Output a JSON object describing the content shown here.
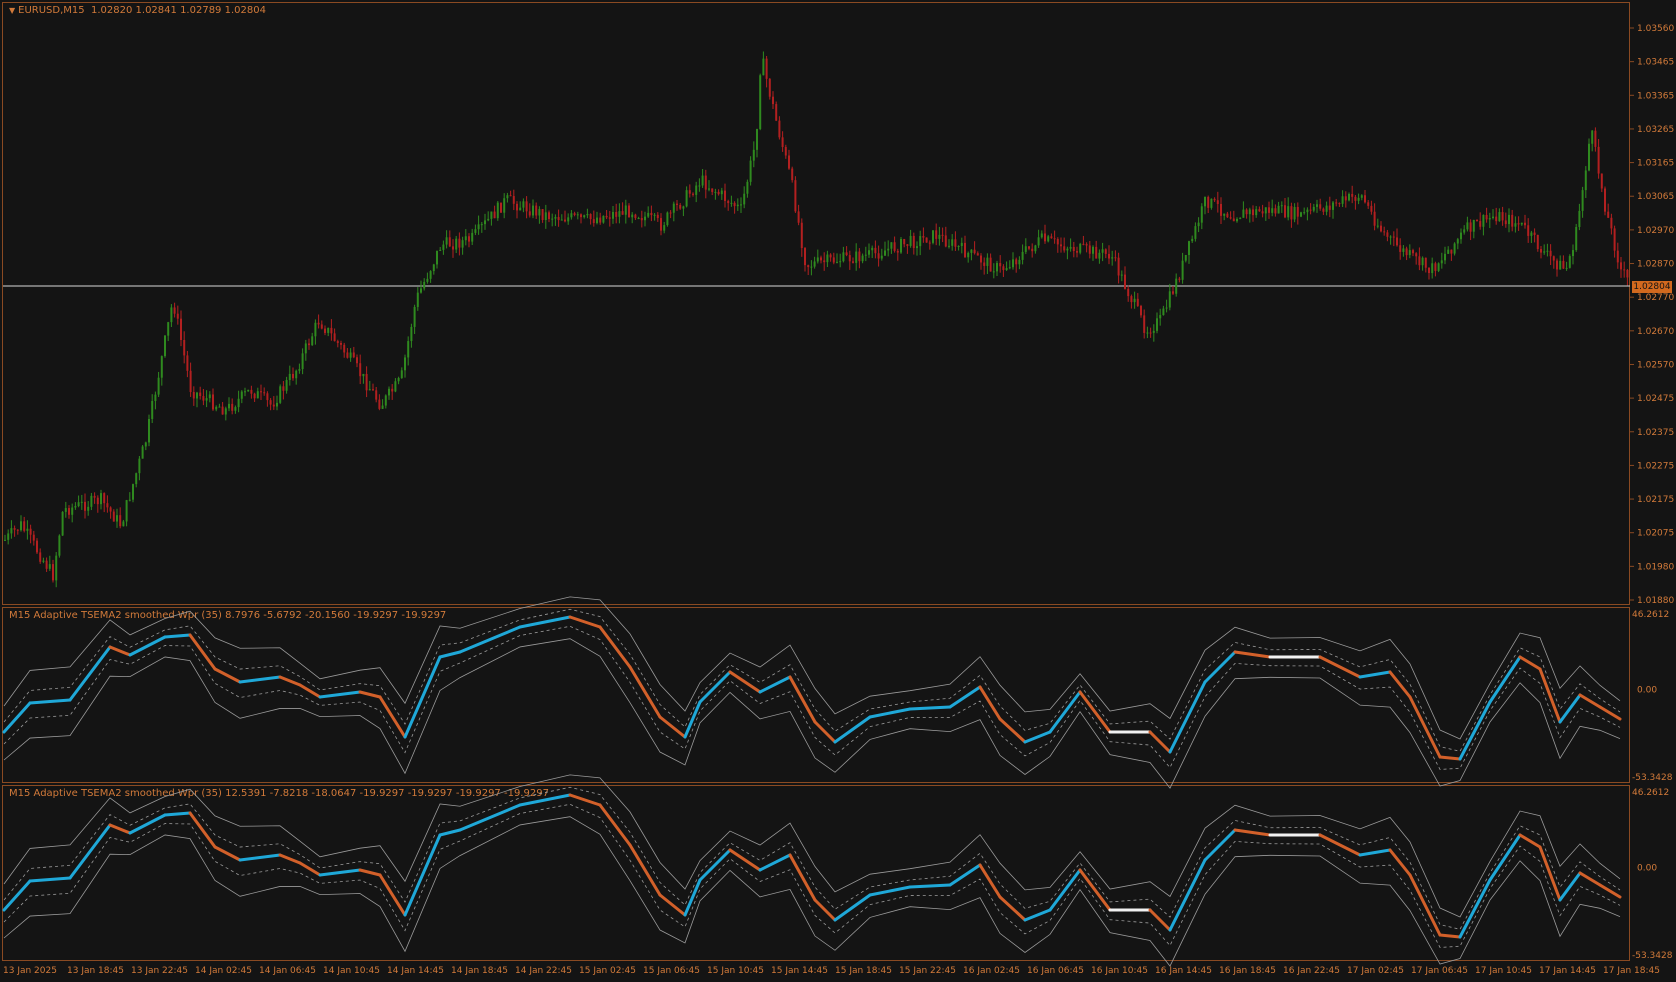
{
  "colors": {
    "background": "#141414",
    "frame": "#8a4a22",
    "text": "#d27a3a",
    "bull": "#2f8a1f",
    "bear": "#b32020",
    "up_line": "#1fa8d8",
    "down_line": "#d2602a",
    "neutral_line": "#f0f0f0",
    "band_line": "#9a9a9a"
  },
  "price_pane": {
    "symbol_label": "EURUSD,M15",
    "ohlc_label": "1.02820 1.02841 1.02789 1.02804",
    "current_price_label": "1.02804",
    "axis_labels": [
      "1.03560",
      "1.03465",
      "1.03365",
      "1.03265",
      "1.03165",
      "1.03065",
      "1.02970",
      "1.02870",
      "1.02770",
      "1.02670",
      "1.02570",
      "1.02475",
      "1.02375",
      "1.02275",
      "1.02175",
      "1.02075",
      "1.01980",
      "1.01880"
    ]
  },
  "indicator_1": {
    "title": "M15 Adaptive TSEMA2 smoothed Wpr (35) 8.7976 -5.6792 -20.1560 -19.9297 -19.9297",
    "axis_top": "46.2612",
    "axis_zero": "0.00",
    "axis_bottom": "-53.3428"
  },
  "indicator_2": {
    "title": "M15 Adaptive TSEMA2 smoothed Wpr (35) 12.5391 -7.8218 -18.0647 -19.9297 -19.9297 -19.9297 -19.9297",
    "axis_top": "46.2612",
    "axis_zero": "0.00",
    "axis_bottom": "-53.3428"
  },
  "time_axis": [
    "13 Jan 2025",
    "13 Jan 18:45",
    "13 Jan 22:45",
    "14 Jan 02:45",
    "14 Jan 06:45",
    "14 Jan 10:45",
    "14 Jan 14:45",
    "14 Jan 18:45",
    "14 Jan 22:45",
    "15 Jan 02:45",
    "15 Jan 06:45",
    "15 Jan 10:45",
    "15 Jan 14:45",
    "15 Jan 18:45",
    "15 Jan 22:45",
    "16 Jan 02:45",
    "16 Jan 06:45",
    "16 Jan 10:45",
    "16 Jan 14:45",
    "16 Jan 18:45",
    "16 Jan 22:45",
    "17 Jan 02:45",
    "17 Jan 06:45",
    "17 Jan 10:45",
    "17 Jan 14:45",
    "17 Jan 18:45"
  ]
}
